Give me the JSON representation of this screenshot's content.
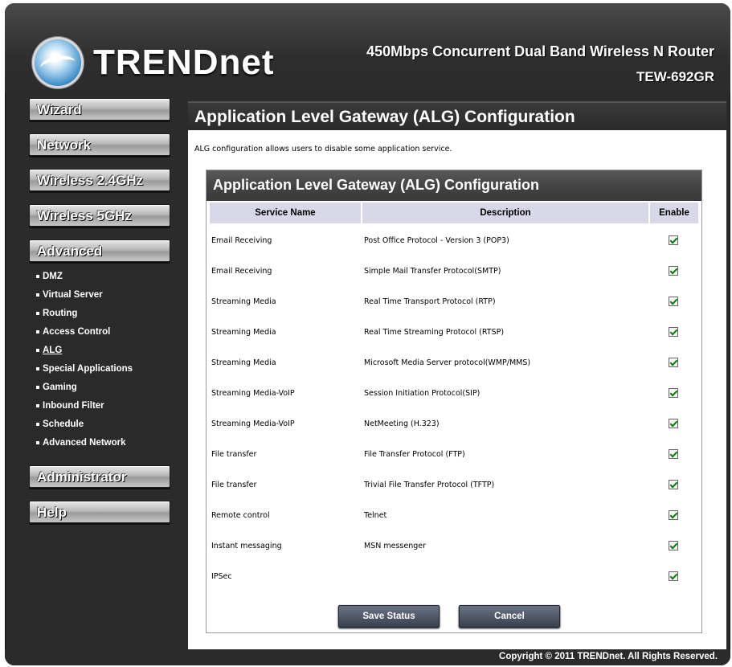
{
  "header": {
    "logo_text": "TRENDnet",
    "product_title": "450Mbps Concurrent Dual Band Wireless N Router",
    "model": "TEW-692GR"
  },
  "sidebar": {
    "menu": [
      {
        "label": "Wizard"
      },
      {
        "label": "Network"
      },
      {
        "label": "Wireless 2.4GHz"
      },
      {
        "label": "Wireless 5GHz"
      },
      {
        "label": "Advanced"
      },
      {
        "label": "Administrator"
      },
      {
        "label": "Help"
      }
    ],
    "advanced_items": [
      {
        "label": "DMZ",
        "active": false
      },
      {
        "label": "Virtual Server",
        "active": false
      },
      {
        "label": "Routing",
        "active": false
      },
      {
        "label": "Access Control",
        "active": false
      },
      {
        "label": "ALG",
        "active": true
      },
      {
        "label": "Special Applications",
        "active": false
      },
      {
        "label": "Gaming",
        "active": false
      },
      {
        "label": "Inbound Filter",
        "active": false
      },
      {
        "label": "Schedule",
        "active": false
      },
      {
        "label": "Advanced Network",
        "active": false
      }
    ]
  },
  "main": {
    "title": "Application Level Gateway (ALG) Configuration",
    "intro": "ALG configuration allows users to disable some application service.",
    "box_title": "Application Level Gateway (ALG) Configuration",
    "columns": [
      "Service Name",
      "Description",
      "Enable"
    ],
    "rows": [
      {
        "service": "Email Receiving",
        "description": "Post Office Protocol - Version 3 (POP3)",
        "enabled": true
      },
      {
        "service": "Email Receiving",
        "description": "Simple Mail Transfer Protocol(SMTP)",
        "enabled": true
      },
      {
        "service": "Streaming Media",
        "description": "Real Time Transport Protocol (RTP)",
        "enabled": true
      },
      {
        "service": "Streaming Media",
        "description": "Real Time Streaming Protocol (RTSP)",
        "enabled": true
      },
      {
        "service": "Streaming Media",
        "description": "Microsoft Media Server protocol(WMP/MMS)",
        "enabled": true
      },
      {
        "service": "Streaming Media-VoIP",
        "description": "Session Initiation Protocol(SIP)",
        "enabled": true
      },
      {
        "service": "Streaming Media-VoIP",
        "description": "NetMeeting (H.323)",
        "enabled": true
      },
      {
        "service": "File transfer",
        "description": "File Transfer Protocol (FTP)",
        "enabled": true
      },
      {
        "service": "File transfer",
        "description": "Trivial File Transfer Protocol (TFTP)",
        "enabled": true
      },
      {
        "service": "Remote control",
        "description": "Telnet",
        "enabled": true
      },
      {
        "service": "Instant messaging",
        "description": "MSN messenger",
        "enabled": true
      },
      {
        "service": "IPSec",
        "description": "",
        "enabled": true
      }
    ],
    "save_label": "Save Status",
    "cancel_label": "Cancel"
  },
  "footer": {
    "copyright": "Copyright © 2011 TRENDnet. All Rights Reserved."
  }
}
